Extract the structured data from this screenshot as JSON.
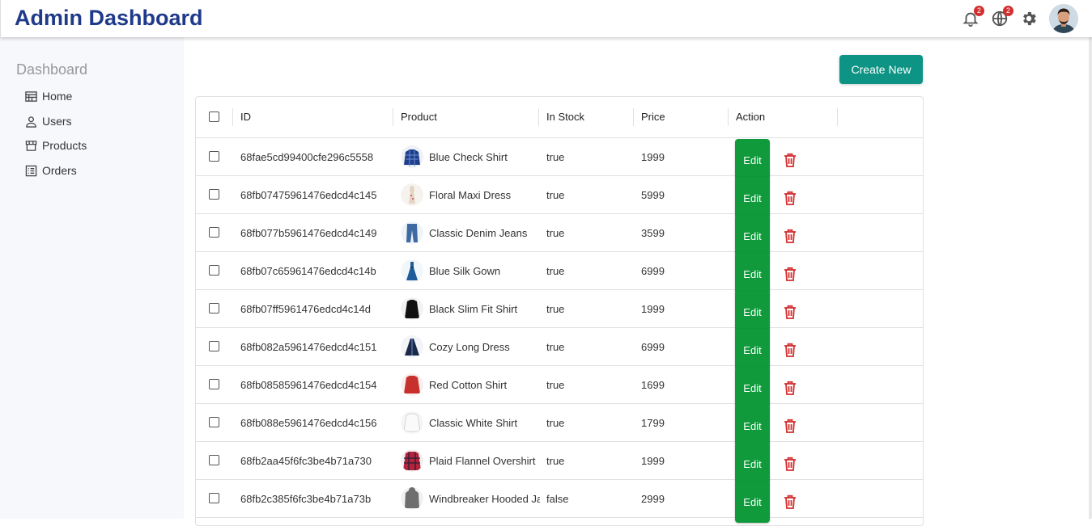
{
  "header": {
    "title": "Admin Dashboard",
    "notifications_count": "2",
    "language_count": "2",
    "icons": [
      "bell-icon",
      "globe-icon",
      "gear-icon",
      "avatar"
    ]
  },
  "sidebar": {
    "title": "Dashboard",
    "items": [
      {
        "label": "Home",
        "icon": "home-icon"
      },
      {
        "label": "Users",
        "icon": "user-icon"
      },
      {
        "label": "Products",
        "icon": "store-icon"
      },
      {
        "label": "Orders",
        "icon": "list-icon"
      }
    ]
  },
  "actions": {
    "create_label": "Create New"
  },
  "table": {
    "columns": [
      "ID",
      "Product",
      "In Stock",
      "Price",
      "Action"
    ],
    "edit_label": "Edit",
    "rows": [
      {
        "id": "68fae5cd99400cfe296c5558",
        "product": "Blue Check Shirt",
        "in_stock": "true",
        "price": "1999"
      },
      {
        "id": "68fb07475961476edcd4c145",
        "product": "Floral Maxi Dress",
        "in_stock": "true",
        "price": "5999"
      },
      {
        "id": "68fb077b5961476edcd4c149",
        "product": "Classic Denim Jeans",
        "in_stock": "true",
        "price": "3599"
      },
      {
        "id": "68fb07c65961476edcd4c14b",
        "product": "Blue Silk Gown",
        "in_stock": "true",
        "price": "6999"
      },
      {
        "id": "68fb07ff5961476edcd4c14d",
        "product": "Black Slim Fit Shirt",
        "in_stock": "true",
        "price": "1999"
      },
      {
        "id": "68fb082a5961476edcd4c151",
        "product": "Cozy Long Dress",
        "in_stock": "true",
        "price": "6999"
      },
      {
        "id": "68fb08585961476edcd4c154",
        "product": "Red Cotton Shirt",
        "in_stock": "true",
        "price": "1699"
      },
      {
        "id": "68fb088e5961476edcd4c156",
        "product": "Classic White Shirt",
        "in_stock": "true",
        "price": "1799"
      },
      {
        "id": "68fb2aa45f6fc3be4b71a730",
        "product": "Plaid Flannel Overshirt",
        "in_stock": "true",
        "price": "1999"
      },
      {
        "id": "68fb2c385f6fc3be4b71a73b",
        "product": "Windbreaker Hooded Jacket",
        "in_stock": "false",
        "price": "2999"
      }
    ]
  },
  "colors": {
    "title": "#1f3a8a",
    "create_button": "#0e9484",
    "edit_button": "#109a3c",
    "delete_icon": "#d32f2f",
    "badge": "#d32f2f",
    "sidebar_bg": "#f7f8fc"
  }
}
